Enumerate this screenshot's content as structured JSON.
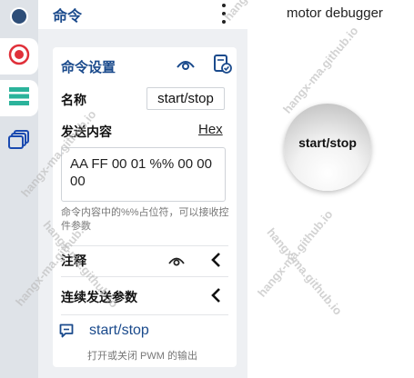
{
  "panel": {
    "title": "命令",
    "card": {
      "title": "命令设置",
      "name_label": "名称",
      "name_value": "start/stop",
      "content_label": "发送内容",
      "hex_link": "Hex",
      "content_value": "AA FF 00 01 %% 00 00 00",
      "helper_text": "命令内容中的%%占位符，可以接收控件参数",
      "comment_label": "注释",
      "continuous_label": "连续发送参数"
    },
    "footer": {
      "command_name": "start/stop",
      "command_desc": "打开或关闭 PWM 的输出"
    }
  },
  "right": {
    "title": "motor debugger",
    "knob_label": "start/stop"
  },
  "watermark": "hangx-ma.github.io",
  "colors": {
    "accent": "#1a4a8c",
    "rail": "#dfe3e8",
    "panel": "#eef0f3",
    "knob_arc": "#e03a3a",
    "green": "#2bb39b",
    "record": "#e0303a"
  }
}
